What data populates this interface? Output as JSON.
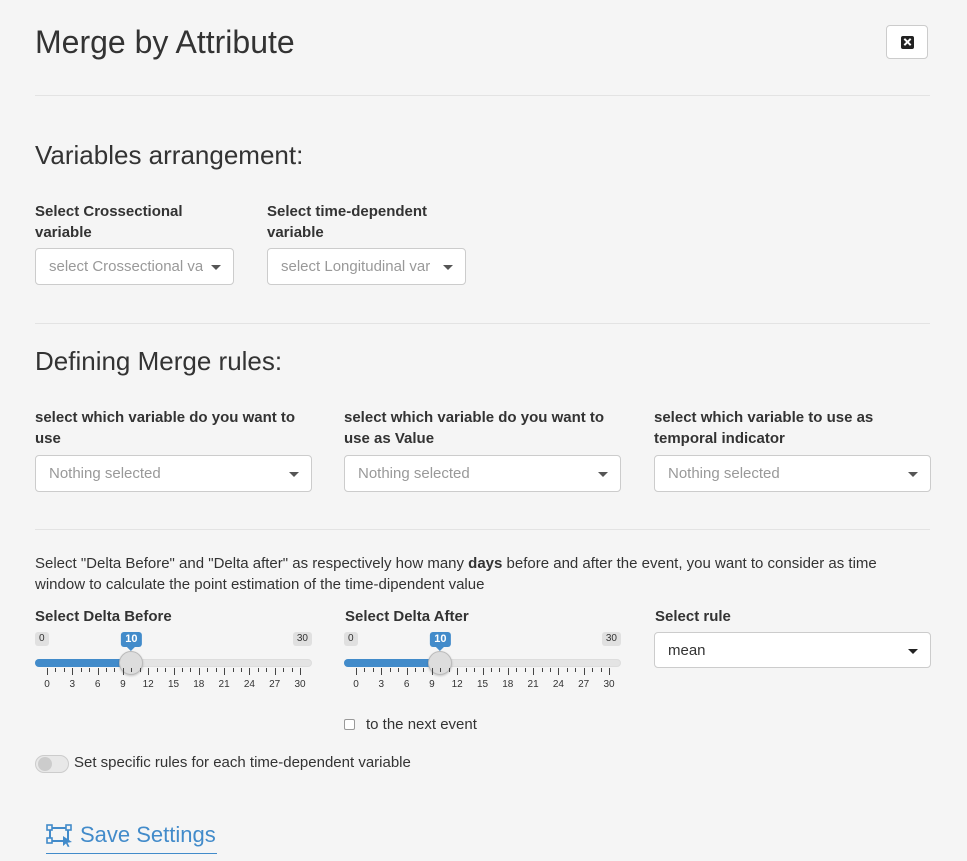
{
  "header": {
    "title": "Merge by Attribute",
    "close_icon": "close-icon"
  },
  "variables": {
    "heading": "Variables arrangement:",
    "cross_label": "Select Crossectional variable",
    "cross_placeholder": "select Crossectional va",
    "time_label": "Select time-dependent variable",
    "time_placeholder": "select Longitudinal var"
  },
  "rules": {
    "heading": "Defining Merge rules:",
    "var_label": "select which variable do you want to use",
    "value_label": "select which variable do you want to use as Value",
    "temporal_label": "select which variable to use as temporal indicator",
    "nothing": "Nothing selected"
  },
  "description": {
    "part1": "Select \"Delta Before\" and \"Delta after\" as respectively how many ",
    "bold": "days",
    "part2": " before and after the event, you want to consider as time window to calculate the point estimation of the time-dipendent value"
  },
  "delta_before": {
    "label": "Select Delta Before",
    "min": "0",
    "max": "30",
    "value": "10",
    "value_num": 10
  },
  "delta_after": {
    "label": "Select Delta After",
    "min": "0",
    "max": "30",
    "value": "10",
    "value_num": 10
  },
  "ticks": [
    "0",
    "3",
    "6",
    "9",
    "12",
    "15",
    "18",
    "21",
    "24",
    "27",
    "30"
  ],
  "rule": {
    "label": "Select rule",
    "value": "mean"
  },
  "next_event": {
    "label": "to the next event",
    "checked": false
  },
  "specific_rules": {
    "label": "Set specific rules for each time-dependent variable",
    "on": false
  },
  "save": {
    "label": "Save Settings",
    "icon": "save-settings-icon"
  },
  "colors": {
    "accent": "#428bca",
    "background": "#f5f5f5"
  }
}
